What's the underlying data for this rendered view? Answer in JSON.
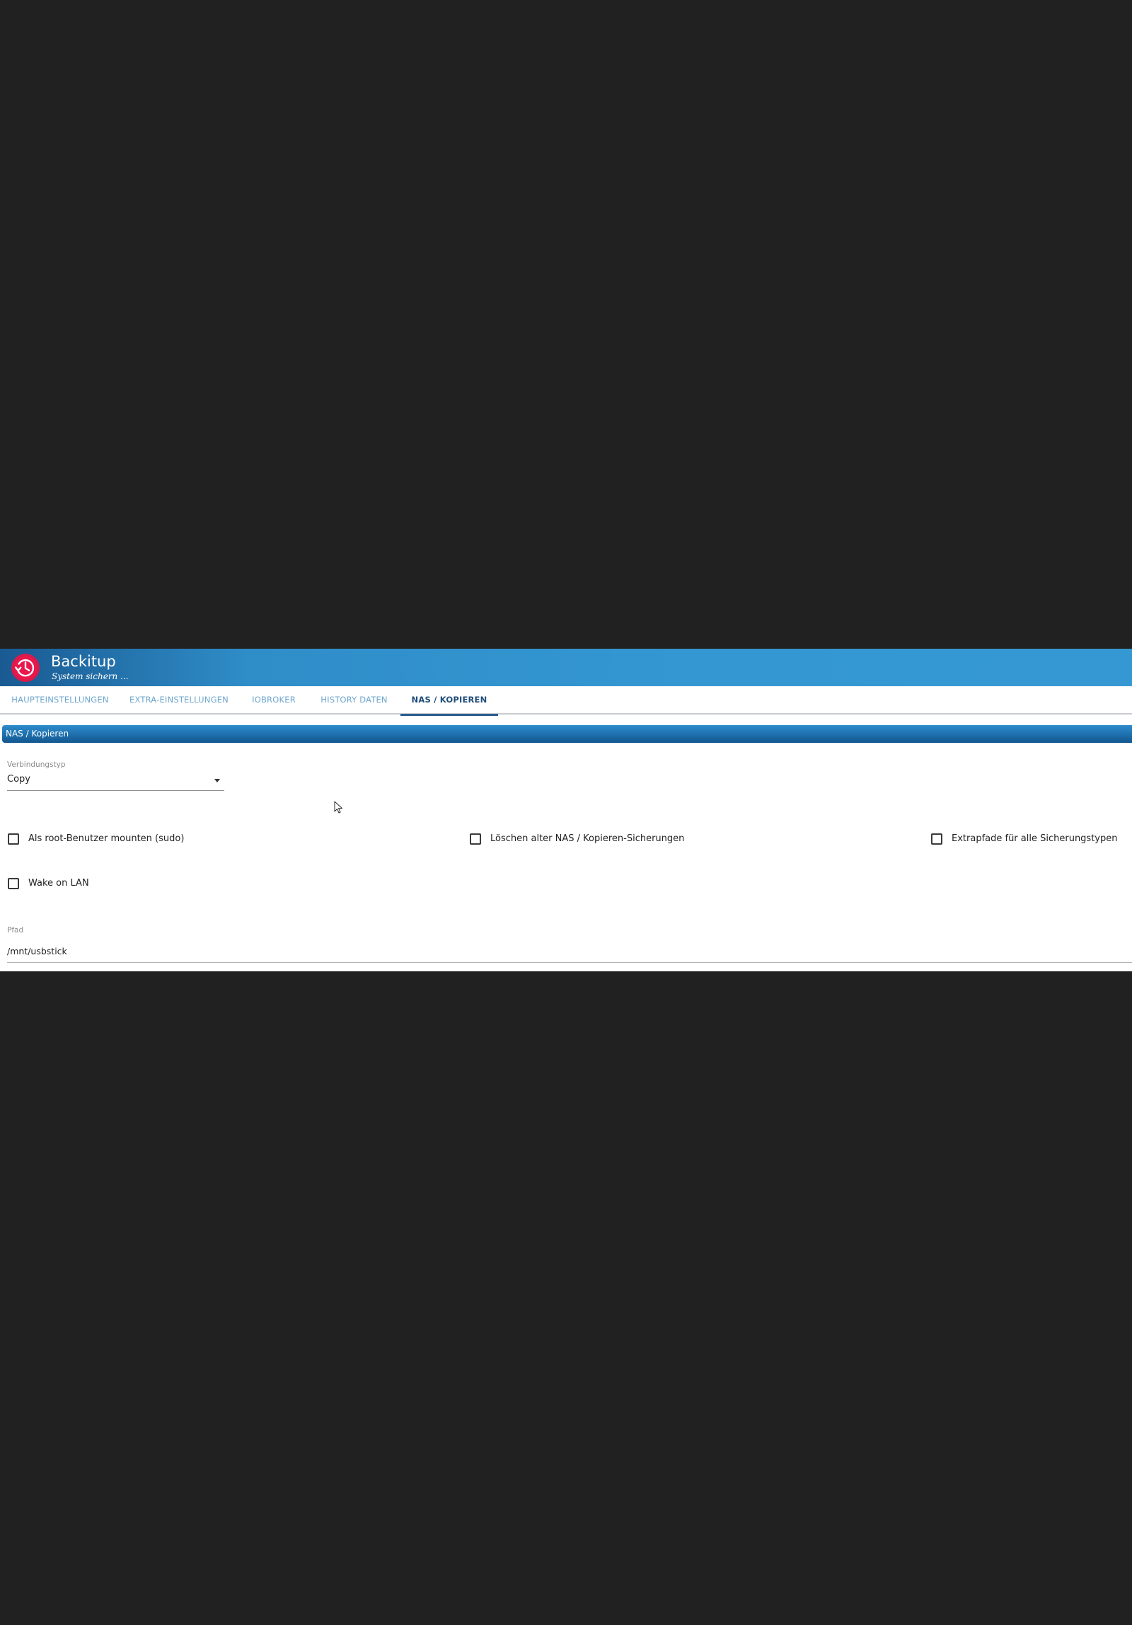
{
  "app": {
    "title": "Backitup",
    "subtitle": "System sichern ...",
    "logo_icon": "history-clock-icon",
    "brand_color": "#3498d2",
    "logo_color": "#e0134a"
  },
  "tabs": [
    {
      "label": "Haupteinstellungen",
      "active": false
    },
    {
      "label": "Extra-Einstellungen",
      "active": false
    },
    {
      "label": "ioBroker",
      "active": false
    },
    {
      "label": "History Daten",
      "active": false
    },
    {
      "label": "NAS / Kopieren",
      "active": true
    }
  ],
  "section": {
    "title": "NAS / Kopieren"
  },
  "connection_type": {
    "label": "Verbindungstyp",
    "value": "Copy"
  },
  "checkboxes": [
    {
      "label": "Als root-Benutzer mounten (sudo)",
      "checked": false
    },
    {
      "label": "Löschen alter NAS / Kopieren-Sicherungen",
      "checked": false
    },
    {
      "label": "Extrapfade für alle Sicherungstypen",
      "checked": false
    },
    {
      "label": "Wake on LAN",
      "checked": false
    }
  ],
  "path": {
    "label": "Pfad",
    "value": "/mnt/usbstick"
  }
}
